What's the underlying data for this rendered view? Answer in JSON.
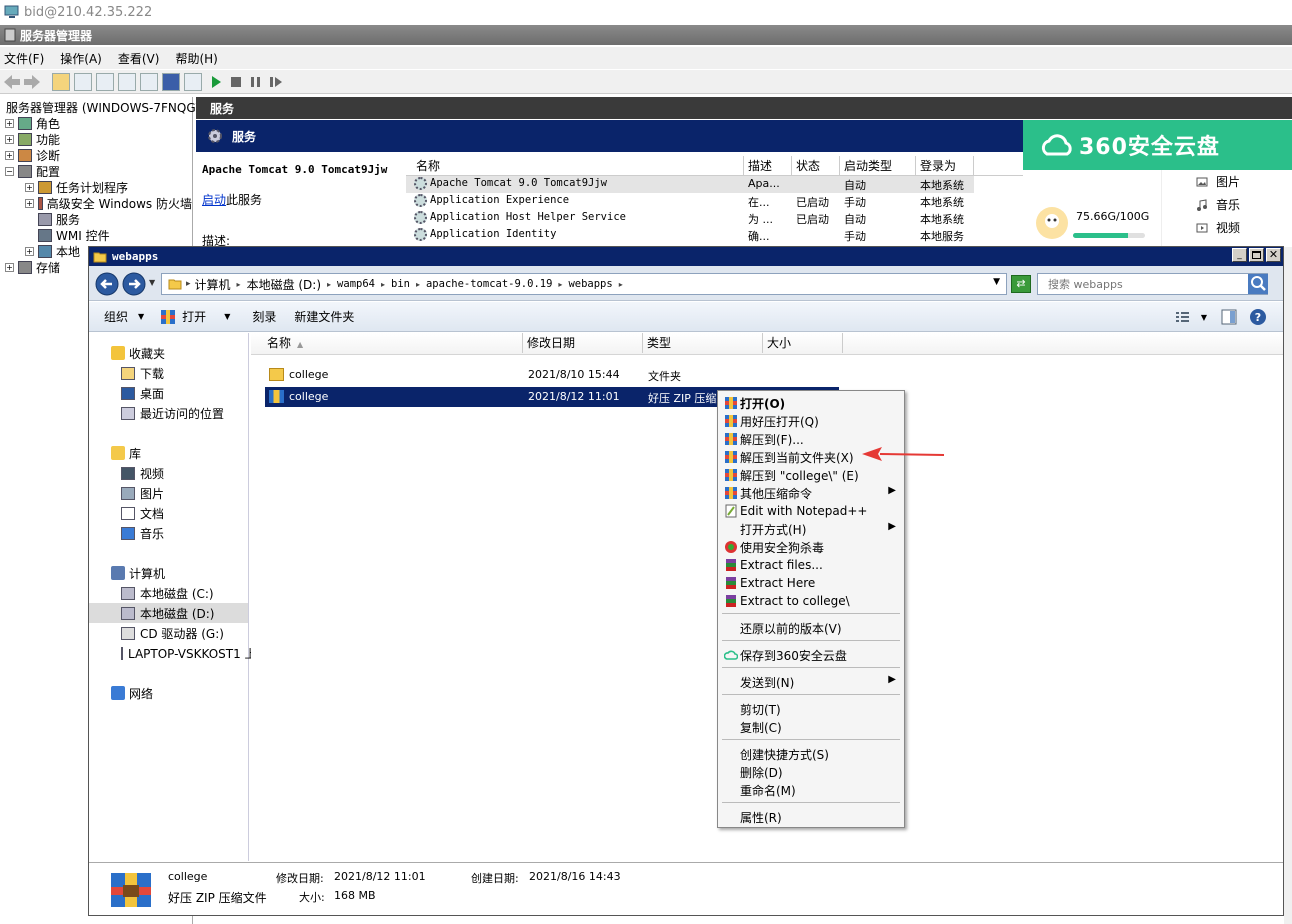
{
  "remote": {
    "title": "bid@210.42.35.222"
  },
  "server_manager": {
    "title": "服务器管理器",
    "menu": [
      "文件(F)",
      "操作(A)",
      "查看(V)",
      "帮助(H)"
    ],
    "tree_root": "服务器管理器 (WINDOWS-7FNQGV",
    "tree": [
      {
        "label": "角色",
        "level": 1
      },
      {
        "label": "功能",
        "level": 1
      },
      {
        "label": "诊断",
        "level": 1
      },
      {
        "label": "配置",
        "level": 1
      },
      {
        "label": "任务计划程序",
        "level": 2
      },
      {
        "label": "高级安全 Windows 防火墙",
        "level": 2
      },
      {
        "label": "服务",
        "level": 2
      },
      {
        "label": "WMI 控件",
        "level": 2
      },
      {
        "label": "本地",
        "level": 2
      },
      {
        "label": "存储",
        "level": 1
      }
    ],
    "pane_title": "服务",
    "header_title": "服务",
    "selected_service": "Apache Tomcat 9.0 Tomcat9Jjw",
    "start_link_prefix": "启动",
    "start_link_suffix": "此服务",
    "desc_label": "描述:",
    "columns": [
      "名称",
      "描述",
      "状态",
      "启动类型",
      "登录为"
    ],
    "services": [
      {
        "name": "Apache Tomcat 9.0 Tomcat9Jjw",
        "desc": "Apa...",
        "status": "",
        "start": "自动",
        "logon": "本地系统"
      },
      {
        "name": "Application Experience",
        "desc": "在...",
        "status": "已启动",
        "start": "手动",
        "logon": "本地系统"
      },
      {
        "name": "Application Host Helper Service",
        "desc": "为 ...",
        "status": "已启动",
        "start": "自动",
        "logon": "本地系统"
      },
      {
        "name": "Application Identity",
        "desc": "确...",
        "status": "",
        "start": "手动",
        "logon": "本地服务"
      }
    ]
  },
  "cloud": {
    "brand": "360安全云盘",
    "storage": "75.66G/100G",
    "storage_fraction": 0.76,
    "items": [
      "图片",
      "音乐",
      "视频"
    ],
    "accent": "#2bbf8a"
  },
  "explorer": {
    "title": "webapps",
    "breadcrumb": [
      "计算机",
      "本地磁盘 (D:)",
      "wamp64",
      "bin",
      "apache-tomcat-9.0.19",
      "webapps"
    ],
    "search_placeholder": "搜索 webapps",
    "toolbar": {
      "organize": "组织",
      "open": "打开",
      "burn": "刻录",
      "new_folder": "新建文件夹"
    },
    "columns": [
      "名称",
      "修改日期",
      "类型",
      "大小"
    ],
    "files": [
      {
        "name": "college",
        "date": "2021/8/10 15:44",
        "type": "文件夹",
        "size": ""
      },
      {
        "name": "college",
        "date": "2021/8/12 11:01",
        "type": "好压 ZIP 压缩文件",
        "size": ""
      }
    ],
    "nav": {
      "favorites": "收藏夹",
      "favorites_items": [
        "下载",
        "桌面",
        "最近访问的位置"
      ],
      "libraries": "库",
      "libraries_items": [
        "视频",
        "图片",
        "文档",
        "音乐"
      ],
      "computer": "计算机",
      "computer_items": [
        "本地磁盘 (C:)",
        "本地磁盘 (D:)",
        "CD 驱动器 (G:)",
        "LAPTOP-VSKKOST1 上"
      ],
      "network": "网络"
    },
    "details": {
      "name": "college",
      "type": "好压 ZIP 压缩文件",
      "modified_label": "修改日期:",
      "modified": "2021/8/12 11:01",
      "created_label": "创建日期:",
      "created": "2021/8/16 14:43",
      "size_label": "大小:",
      "size": "168 MB"
    }
  },
  "context_menu": {
    "groups": [
      [
        {
          "label": "打开(O)",
          "icon": "zip-icon",
          "bold": true
        },
        {
          "label": "用好压打开(Q)",
          "icon": "zip-icon"
        },
        {
          "label": "解压到(F)...",
          "icon": "zip-icon"
        },
        {
          "label": "解压到当前文件夹(X)",
          "icon": "zip-icon"
        },
        {
          "label": "解压到 \"college\\\" (E)",
          "icon": "zip-icon"
        },
        {
          "label": "其他压缩命令",
          "icon": "zip-icon",
          "submenu": true
        },
        {
          "label": "Edit with Notepad++",
          "icon": "notepad-icon"
        },
        {
          "label": "打开方式(H)",
          "icon": "",
          "submenu": true
        },
        {
          "label": "使用安全狗杀毒",
          "icon": "antivirus-icon"
        },
        {
          "label": "Extract files...",
          "icon": "rar-icon"
        },
        {
          "label": "Extract Here",
          "icon": "rar-icon"
        },
        {
          "label": "Extract to college\\",
          "icon": "rar-icon"
        }
      ],
      [
        {
          "label": "还原以前的版本(V)",
          "icon": ""
        }
      ],
      [
        {
          "label": "保存到360安全云盘",
          "icon": "cloud-icon"
        }
      ],
      [
        {
          "label": "发送到(N)",
          "icon": "",
          "submenu": true
        }
      ],
      [
        {
          "label": "剪切(T)",
          "icon": ""
        },
        {
          "label": "复制(C)",
          "icon": ""
        }
      ],
      [
        {
          "label": "创建快捷方式(S)",
          "icon": ""
        },
        {
          "label": "删除(D)",
          "icon": ""
        },
        {
          "label": "重命名(M)",
          "icon": ""
        }
      ],
      [
        {
          "label": "属性(R)",
          "icon": ""
        }
      ]
    ]
  }
}
